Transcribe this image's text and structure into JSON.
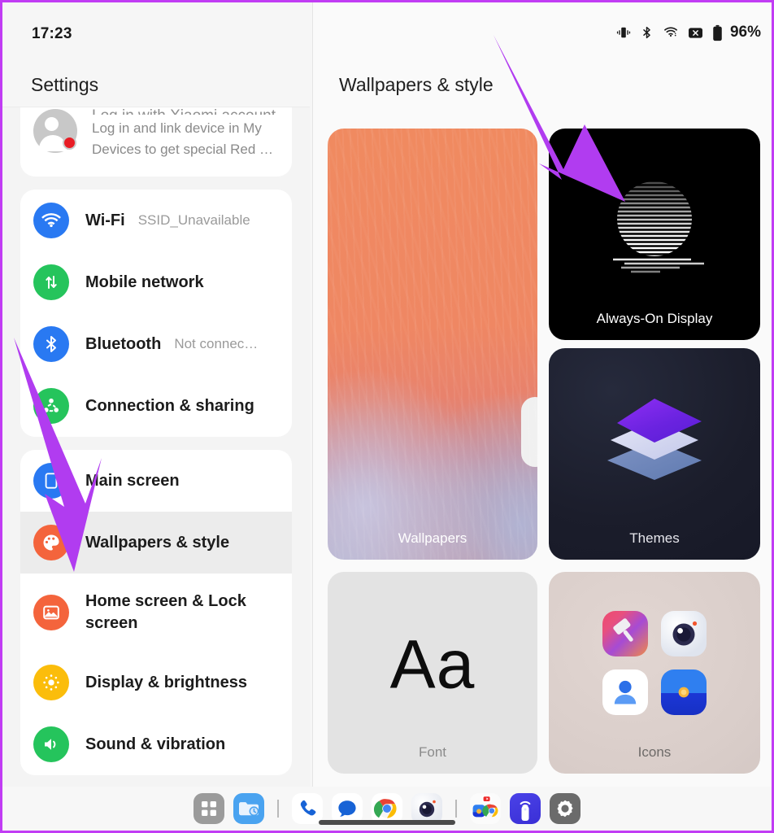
{
  "theme": {
    "arrow_color": "#b13cf0",
    "border_color": "#c13cf4",
    "accent_orange": "#f4643c",
    "accent_blue": "#1a73e8",
    "accent_green": "#25c45c",
    "accent_yellow": "#fbbd0b"
  },
  "left_panel": {
    "clock": "17:23",
    "title": "Settings",
    "account_card": {
      "title_clipped": "Log in with Xiaomi account",
      "description": "Log in and link device in My Devices to get special Red …",
      "avatar_icon": "account-avatar-icon",
      "badge_dot_color": "#e81c24"
    },
    "groups": [
      {
        "id": "connectivity",
        "items": [
          {
            "label": "Wi-Fi",
            "value": "SSID_Unavailable",
            "icon": "wifi-icon",
            "icon_color": "#2979f2"
          },
          {
            "label": "Mobile network",
            "value": "",
            "icon": "mobile-network-icon",
            "icon_color": "#25c45c"
          },
          {
            "label": "Bluetooth",
            "value": "Not connec…",
            "icon": "bluetooth-icon",
            "icon_color": "#2979f2"
          },
          {
            "label": "Connection & sharing",
            "value": "",
            "icon": "connection-sharing-icon",
            "icon_color": "#25c45c"
          }
        ]
      },
      {
        "id": "personalization",
        "items": [
          {
            "label": "Main screen",
            "value": "",
            "icon": "main-screen-icon",
            "icon_color": "#2979f2",
            "selected": false
          },
          {
            "label": "Wallpapers & style",
            "value": "",
            "icon": "palette-icon",
            "icon_color": "#f4643c",
            "selected": true
          },
          {
            "label": "Home screen & Lock screen",
            "value": "",
            "icon": "image-icon",
            "icon_color": "#f4643c",
            "selected": false
          },
          {
            "label": "Display & brightness",
            "value": "",
            "icon": "brightness-icon",
            "icon_color": "#fbbd0b",
            "selected": false
          },
          {
            "label": "Sound & vibration",
            "value": "",
            "icon": "sound-icon",
            "icon_color": "#25c45c",
            "selected": false
          }
        ]
      }
    ]
  },
  "right_panel": {
    "title": "Wallpapers & style",
    "status_bar": {
      "battery_percent": "96%",
      "icons": [
        "vibrate-icon",
        "bluetooth-icon",
        "wifi-icon",
        "no-sim-icon",
        "battery-icon"
      ]
    },
    "tiles": [
      {
        "id": "wallpapers",
        "label": "Wallpapers"
      },
      {
        "id": "always-on-display",
        "label": "Always-On Display"
      },
      {
        "id": "themes",
        "label": "Themes"
      },
      {
        "id": "font",
        "label": "Font",
        "preview_text": "Aa"
      },
      {
        "id": "icons",
        "label": "Icons"
      }
    ],
    "icons_tile_apps": [
      "themes-app-icon",
      "camera-app-icon",
      "contacts-app-icon",
      "gallery-app-icon"
    ]
  },
  "taskbar": {
    "items": [
      {
        "name": "app-drawer-icon"
      },
      {
        "name": "file-manager-icon"
      },
      {
        "name": "separator"
      },
      {
        "name": "phone-icon"
      },
      {
        "name": "messages-icon"
      },
      {
        "name": "chrome-icon"
      },
      {
        "name": "camera-icon"
      },
      {
        "name": "separator"
      },
      {
        "name": "recent-apps-folder-icon"
      },
      {
        "name": "mi-remote-icon"
      },
      {
        "name": "settings-gear-icon"
      }
    ]
  },
  "annotations": {
    "arrows": [
      {
        "id": "arrow-to-wallpapers-style",
        "from": "top-left",
        "to": "wallpapers-style-row"
      },
      {
        "id": "arrow-to-always-on-display",
        "from": "top-right",
        "to": "always-on-display-tile"
      }
    ]
  }
}
